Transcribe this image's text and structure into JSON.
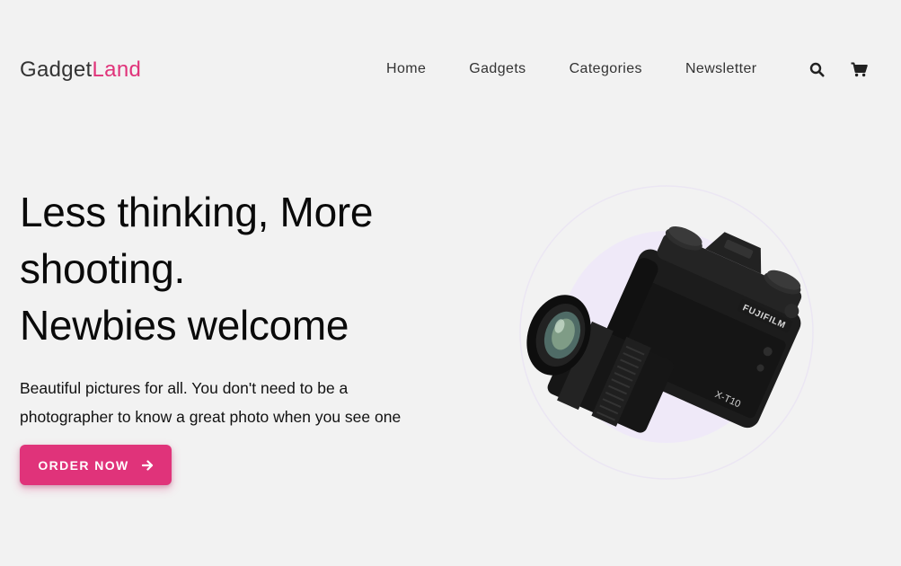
{
  "header": {
    "logo_part1": "Gadget",
    "logo_part2": "Land",
    "nav": [
      "Home",
      "Gadgets",
      "Categories",
      "Newsletter"
    ],
    "search_icon": "search-icon",
    "cart_icon": "cart-icon"
  },
  "hero": {
    "title_lines": [
      "Less thinking, More",
      "shooting.",
      "Newbies welcome"
    ],
    "subtitle_line1": "Beautiful pictures for all. You don't need to be a",
    "subtitle_line2": "photographer to know a great photo when you see one",
    "cta_label": "ORDER NOW",
    "cta_icon": "arrow-right-icon"
  },
  "image": {
    "brand": "FUJIFILM",
    "model": "X-T10",
    "icon": "camera-image"
  },
  "colors": {
    "accent": "#e0337a",
    "background": "#f2f2f2",
    "circle": "#efe9f8"
  }
}
